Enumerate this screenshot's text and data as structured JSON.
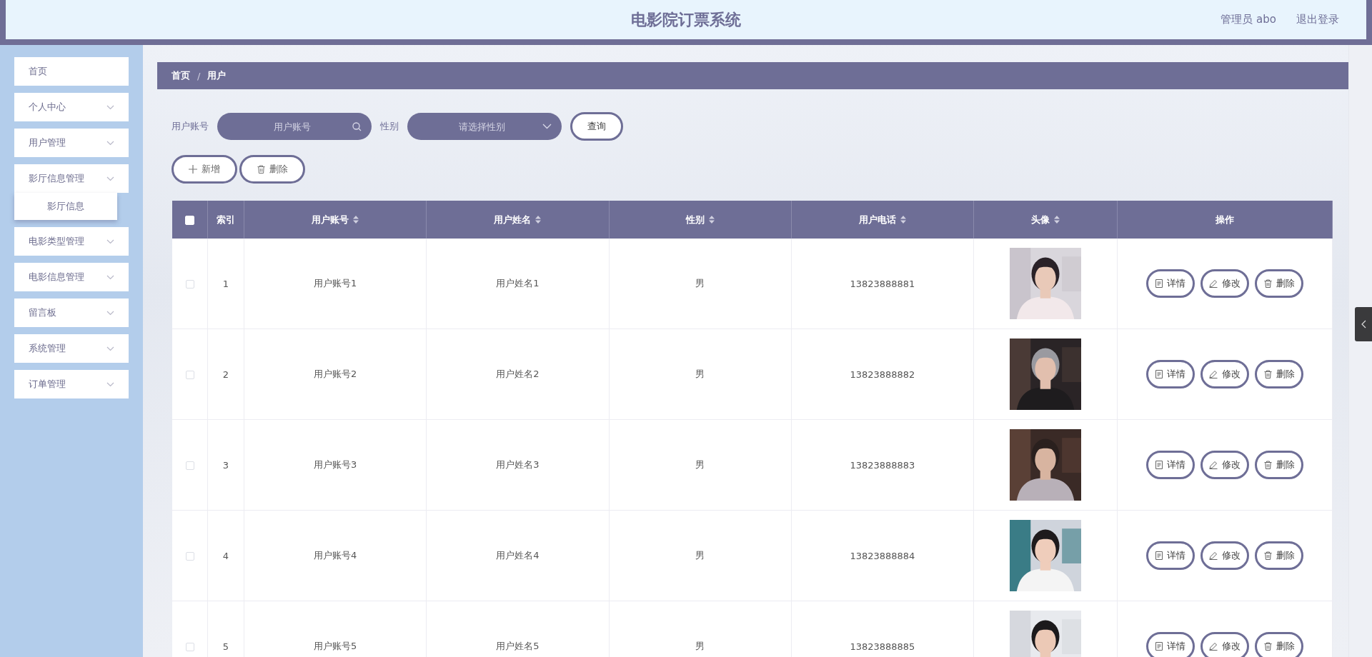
{
  "header": {
    "title": "电影院订票系统",
    "user": "管理员 abo",
    "logout": "退出登录"
  },
  "sidebar": {
    "items": [
      {
        "label": "首页",
        "kind": "link"
      },
      {
        "label": "个人中心",
        "kind": "menu"
      },
      {
        "label": "用户管理",
        "kind": "menu"
      },
      {
        "label": "影厅信息管理",
        "kind": "menu",
        "children": [
          {
            "label": "影厅信息"
          }
        ]
      },
      {
        "label": "电影类型管理",
        "kind": "menu"
      },
      {
        "label": "电影信息管理",
        "kind": "menu"
      },
      {
        "label": "留言板",
        "kind": "menu"
      },
      {
        "label": "系统管理",
        "kind": "menu"
      },
      {
        "label": "订单管理",
        "kind": "menu"
      }
    ]
  },
  "breadcrumb": {
    "items": [
      "首页",
      "用户"
    ],
    "separator": "/"
  },
  "search": {
    "fields": [
      {
        "label": "用户账号",
        "placeholder": "用户账号",
        "kind": "text"
      },
      {
        "label": "性别",
        "placeholder": "请选择性别",
        "kind": "select"
      }
    ],
    "button": "查询"
  },
  "actions": [
    {
      "label": "新增",
      "kind": "add"
    },
    {
      "label": "删除",
      "kind": "delete"
    }
  ],
  "table": {
    "select_all_checked": false,
    "columns": [
      {
        "label": "索引",
        "kind": "plain"
      },
      {
        "label": "用户账号",
        "kind": "sortable"
      },
      {
        "label": "用户姓名",
        "kind": "sortable"
      },
      {
        "label": "性别",
        "kind": "sortable"
      },
      {
        "label": "用户电话",
        "kind": "sortable"
      },
      {
        "label": "头像",
        "kind": "sortable"
      },
      {
        "label": "操作",
        "kind": "plain"
      }
    ],
    "rows": [
      {
        "checked": false,
        "index": "1",
        "account": "用户账号1",
        "name": "用户姓名1",
        "gender": "男",
        "phone": "13823888881",
        "actions": [
          {
            "label": "详情",
            "kind": "detail"
          },
          {
            "label": "修改",
            "kind": "edit"
          },
          {
            "label": "删除",
            "kind": "delete"
          }
        ]
      },
      {
        "checked": false,
        "index": "2",
        "account": "用户账号2",
        "name": "用户姓名2",
        "gender": "男",
        "phone": "13823888882",
        "actions": [
          {
            "label": "详情",
            "kind": "detail"
          },
          {
            "label": "修改",
            "kind": "edit"
          },
          {
            "label": "删除",
            "kind": "delete"
          }
        ]
      },
      {
        "checked": false,
        "index": "3",
        "account": "用户账号3",
        "name": "用户姓名3",
        "gender": "男",
        "phone": "13823888883",
        "actions": [
          {
            "label": "详情",
            "kind": "detail"
          },
          {
            "label": "修改",
            "kind": "edit"
          },
          {
            "label": "删除",
            "kind": "delete"
          }
        ]
      },
      {
        "checked": false,
        "index": "4",
        "account": "用户账号4",
        "name": "用户姓名4",
        "gender": "男",
        "phone": "13823888884",
        "actions": [
          {
            "label": "详情",
            "kind": "detail"
          },
          {
            "label": "修改",
            "kind": "edit"
          },
          {
            "label": "删除",
            "kind": "delete"
          }
        ]
      },
      {
        "checked": false,
        "index": "5",
        "account": "用户账号5",
        "name": "用户姓名5",
        "gender": "男",
        "phone": "13823888885",
        "actions": [
          {
            "label": "详情",
            "kind": "detail"
          },
          {
            "label": "修改",
            "kind": "edit"
          },
          {
            "label": "删除",
            "kind": "delete"
          }
        ]
      }
    ]
  }
}
